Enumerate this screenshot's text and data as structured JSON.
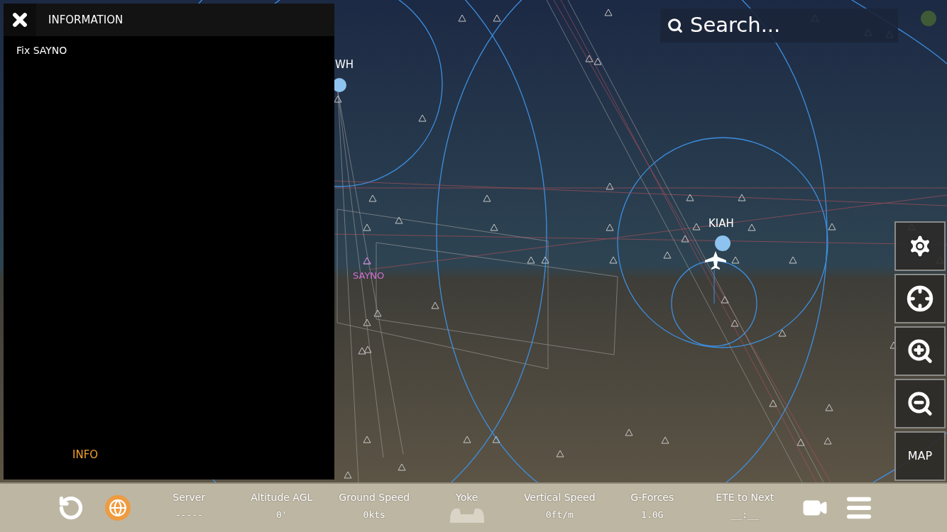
{
  "panel": {
    "title": "INFORMATION",
    "subtitle": "Fix SAYNO",
    "footer_tab": "INFO"
  },
  "search": {
    "placeholder": "Search..."
  },
  "map": {
    "labels": [
      {
        "text": "WH",
        "kind": "airport"
      },
      {
        "text": "KIAH",
        "kind": "airport"
      },
      {
        "text": "SAYNO",
        "kind": "fix"
      }
    ]
  },
  "side_buttons": [
    {
      "kind": "settings"
    },
    {
      "kind": "locate"
    },
    {
      "kind": "zoom-in"
    },
    {
      "kind": "zoom-out"
    },
    {
      "kind": "text",
      "label": "MAP"
    }
  ],
  "status_bar": {
    "stats": [
      {
        "kind": "value",
        "label": "Server",
        "value": "-----"
      },
      {
        "kind": "value",
        "label": "Altitude AGL",
        "value": "0'"
      },
      {
        "kind": "value",
        "label": "Ground Speed",
        "value": "0kts"
      },
      {
        "kind": "yoke",
        "label": "Yoke"
      },
      {
        "kind": "value",
        "label": "Vertical Speed",
        "value": "0ft/m"
      },
      {
        "kind": "value",
        "label": "G-Forces",
        "value": "1.0G"
      },
      {
        "kind": "value",
        "label": "ETE to Next",
        "value": "__:__"
      }
    ]
  }
}
